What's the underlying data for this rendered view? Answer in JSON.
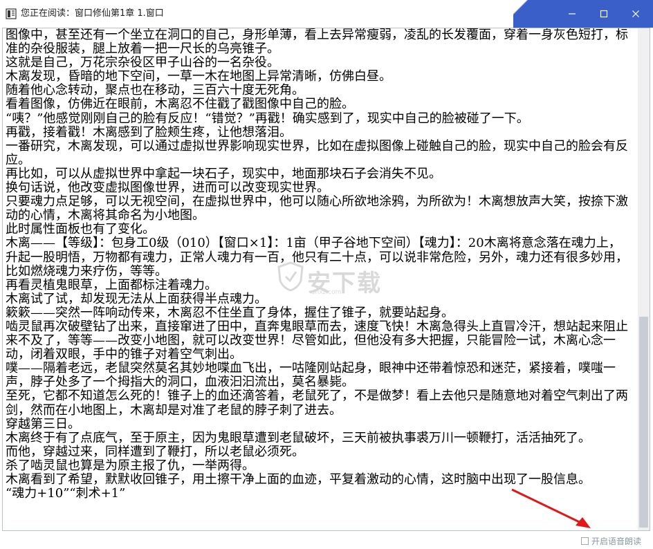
{
  "window": {
    "title": "您正在阅读：窗口修仙第1章 1.窗口",
    "minimize_glyph": "—",
    "maximize_glyph": "☐",
    "close_glyph": "✕"
  },
  "reader": {
    "paragraphs": [
      "图像中，甚至还有一个坐立在洞口的自己，身形单薄，看上去异常瘦弱，凌乱的长发覆面，穿着一身灰色短打，标准的杂役服装，腿上放着一把一尺长的乌亮锥子。",
      "这就是自己，万花宗杂役区甲子山谷的一名杂役。",
      "木离发现，昏暗的地下空间，一草一木在地图上异常清晰，仿佛白昼。",
      "随着他心念转动，聚点也在移动，三百六十度无死角。",
      "看着图像，仿佛近在眼前，木离忍不住戳了戳图像中自己的脸。",
      "“咦？”他感觉刚刚自己的脸有反应！“错觉？”再戳！确实感到了，现实中自己的脸被碰了一下。",
      "再戳，接着戳！木离感到了脸颊生疼，让他想落泪。",
      "一番研究，木离发现，可以通过虚拟世界影响现实世界，比如在虚拟图像上碰触自己的脸，现实中自己的脸会有反应。",
      "再比如，可以从虚拟世界中拿起一块石子，现实中，地面那块石子会消失不见。",
      "换句话说，他改变虚拟图像世界，进而可以改变现实世界。",
      "只要魂力点足够，可以无视空间，在虚拟世界中，他可以随心所欲地涂鸦，为所欲为！木离想放声大笑，按捺下激动的心情，木离将其命名为小地图。",
      "此时属性面板也有了变化。",
      "木离——【等级】：包身工0级（010）【窗口×1】：1亩（甲子谷地下空间）【魂力】：20木离将意念落在魂力上，升起一股明悟，万物都有魂力，正常人魂力有一百，他只有二十点，可以说非常危险，另外，魂力还有很多妙用，比如燃烧魂力来疗伤，等等。",
      "再看灵植鬼眼草，上面都标注着魂力。",
      "木离试了试，却发现无法从上面获得半点魂力。",
      "簌簌——突然一阵响动传来，木离忍不住坐直了身体，握住了锥子，就要站起身。",
      "啮灵鼠再次破壁钻了出来，直接窜进了田中，直奔鬼眼草而去，速度飞快！木离急得头上直冒冷汗，想站起来阻止来不及了，等等——改变小地图，就可以改变世界！尽管如此，但他没有多大把握，只能冒险一试，木离心念一动，闭着双眼，手中的锥子对着空气刺出。",
      "噗——隔着老远，老鼠突然莫名其妙地喋血飞出，一咕隆刚站起身，眼神中还带着惊恐和迷茫，紧接着，噗嗤一声，脖子处多了一个拇指大的洞口，血液汩汩流出，莫名暴毙。",
      "至死，它都不知道怎么死的！锥子上的血还滴答着，老鼠死了，不是做梦！看上去他只是随意地对着空气刺出了两剑，然而在小地图上，木离却是对准了老鼠的脖子刺了进去。",
      "穿越第三日。",
      "木离终于有了点底气，至于原主，因为鬼眼草遭到老鼠破坏，三天前被执事裘万川一顿鞭打，活活抽死了。",
      "而他，穿越过来，同样遭到了鞭打，所以老鼠必须死。",
      "杀了啮灵鼠也算是为原主报了仇，一举两得。",
      "木离看到了希望，默默收回锥子，用土擦干净上面的血迹，平复着激动的心情，这时脑中出现了一股信息。",
      "“魂力+10”“刺术+1”"
    ]
  },
  "watermark": {
    "text": "安下载",
    "sub": "anxz.com"
  },
  "footer": {
    "tts_label": "开启语音朗读",
    "tts_checked": false
  },
  "colors": {
    "title_accent": "#3a5fc8",
    "frame_border": "#b9c2cc",
    "arrow": "#e01818",
    "tts_text": "#8a97a8"
  }
}
